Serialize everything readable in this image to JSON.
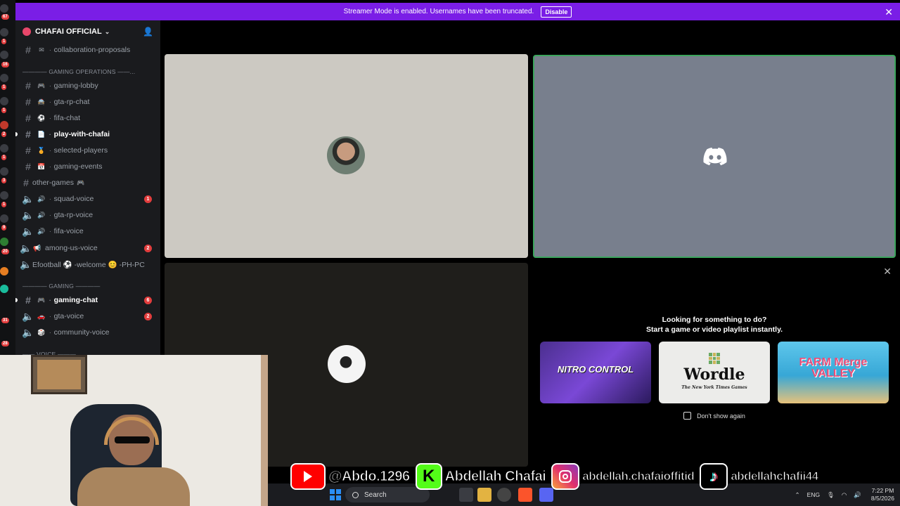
{
  "banner": {
    "message": "Streamer Mode is enabled. Usernames have been truncated.",
    "button": "Disable",
    "close": "✕"
  },
  "server": {
    "name": "CHAFAI OFFICIAL"
  },
  "server_badges": [
    "67",
    "1",
    "16",
    "1",
    "1",
    "2",
    "1",
    "3",
    "1",
    "9",
    "20",
    "31",
    "28"
  ],
  "channels": {
    "collab": "collaboration-proposals",
    "cat_ops": "———— GAMING OPERATIONS ——...",
    "gaming_lobby": "gaming-lobby",
    "gta_rp_chat": "gta-rp-chat",
    "fifa_chat": "fifa-chat",
    "play_with_chafai": "play-with-chafai",
    "selected_players": "selected-players",
    "gaming_events": "gaming-events",
    "other_games": "other-games",
    "squad_voice": "squad-voice",
    "squad_voice_badge": "1",
    "gta_rp_voice": "gta-rp-voice",
    "fifa_voice": "fifa-voice",
    "among_us_voice": "among-us-voice",
    "among_us_badge": "2",
    "efootball": "Efootball ⚽ -welcome 😊 -PH-PC",
    "cat_gaming": "———— GAMING ————",
    "gaming_chat": "gaming-chat",
    "gaming_chat_badge": "6",
    "gta_voice": "gta-voice",
    "gta_voice_badge": "2",
    "community_voice": "community-voice",
    "cat_voice": "—— VOICE ———"
  },
  "activity": {
    "title_line1": "Looking for something to do?",
    "title_line2": "Start a game or video playlist instantly.",
    "cards": [
      {
        "name": "NITRO CONTROL"
      },
      {
        "name": "Wordle",
        "sub": "The New York Times Games"
      },
      {
        "name": "FARM Merge VALLEY"
      }
    ],
    "dont_show": "Don't show again"
  },
  "social": {
    "youtube": "@Abdo.1296",
    "kick": "Abdellah Chafai",
    "instagram": "abdellah.chafaioffitid",
    "tiktok": "abdellahchafii44"
  },
  "taskbar": {
    "search": "Search",
    "lang": "ENG",
    "time": "7:22 PM",
    "date": "8/5/2026"
  },
  "colors": {
    "banner": "#7a1ee6",
    "speaking_border": "#3ba55c",
    "badge": "#e23d3d"
  }
}
